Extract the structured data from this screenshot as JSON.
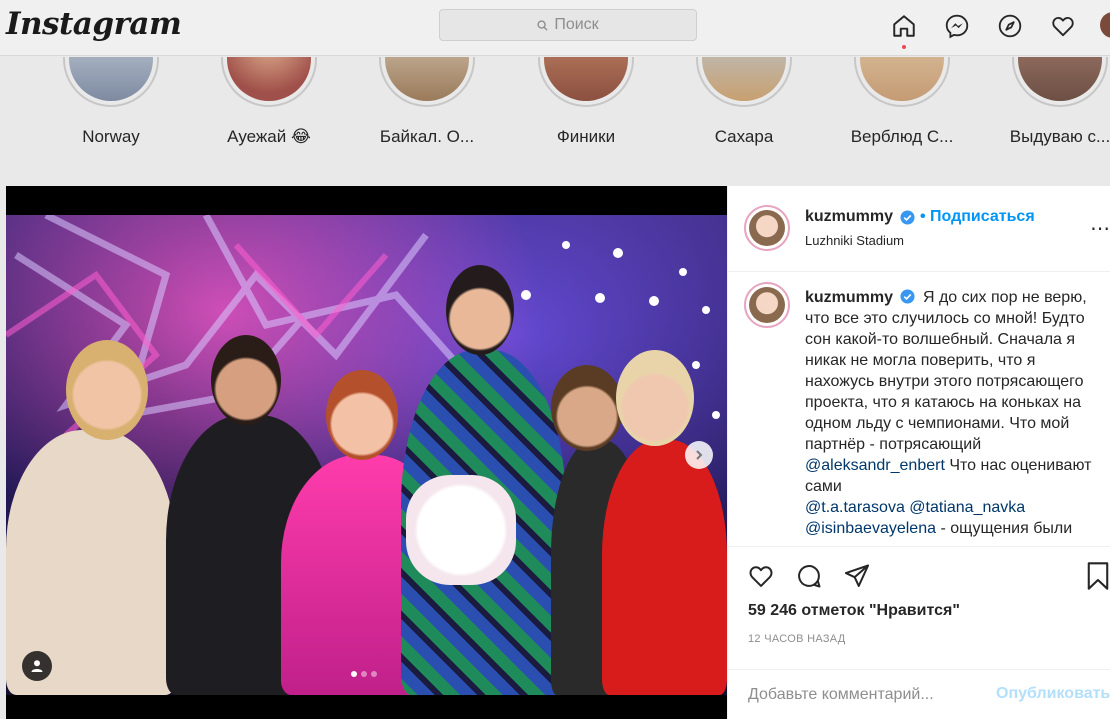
{
  "header": {
    "logo": "Instagram",
    "search_placeholder": "Поиск"
  },
  "stories": [
    {
      "label": "Norway",
      "color": "#7d8aa0"
    },
    {
      "label": "Ауежай 😂",
      "color": "#a0504a"
    },
    {
      "label": "Байкал. О...",
      "color": "#9a7a5a"
    },
    {
      "label": "Финики",
      "color": "#8b5040"
    },
    {
      "label": "Сахара",
      "color": "#c8a070"
    },
    {
      "label": "Верблюд С...",
      "color": "#c49b74"
    },
    {
      "label": "Выдуваю с...",
      "color": "#6d4f44"
    }
  ],
  "post": {
    "username": "kuzmummy",
    "follow_label": "Подписаться",
    "location": "Luzhniki Stadium",
    "caption": {
      "username": "kuzmummy",
      "text_1": "Я до сих пор не верю, что все это случилось со мной! Будто сон какой-то волшебный. Сначала я никак не могла поверить, что я нахожусь внутри этого потрясающего проекта, что я катаюсь на коньках на одном льду с чемпионами. Что мой партнёр - потрясающий ",
      "mention_1": "@aleksandr_enbert",
      "text_2": " Что нас оценивают сами ",
      "mention_2": "@t.a.tarasova",
      "mention_3": "@tatiana_navka",
      "mention_4": "@isinbaevayelena",
      "text_3": " - ощущения были"
    },
    "likes": "59 246 отметок \"Нравится\"",
    "time": "12 ЧАСОВ НАЗАД",
    "comment_placeholder": "Добавьте комментарий...",
    "publish_label": "Опубликовать",
    "carousel_dots": 3,
    "carousel_active": 1
  },
  "colors": {
    "accent": "#0095f6",
    "notification": "#ed4956",
    "publish_disabled": "#b2dffc"
  }
}
